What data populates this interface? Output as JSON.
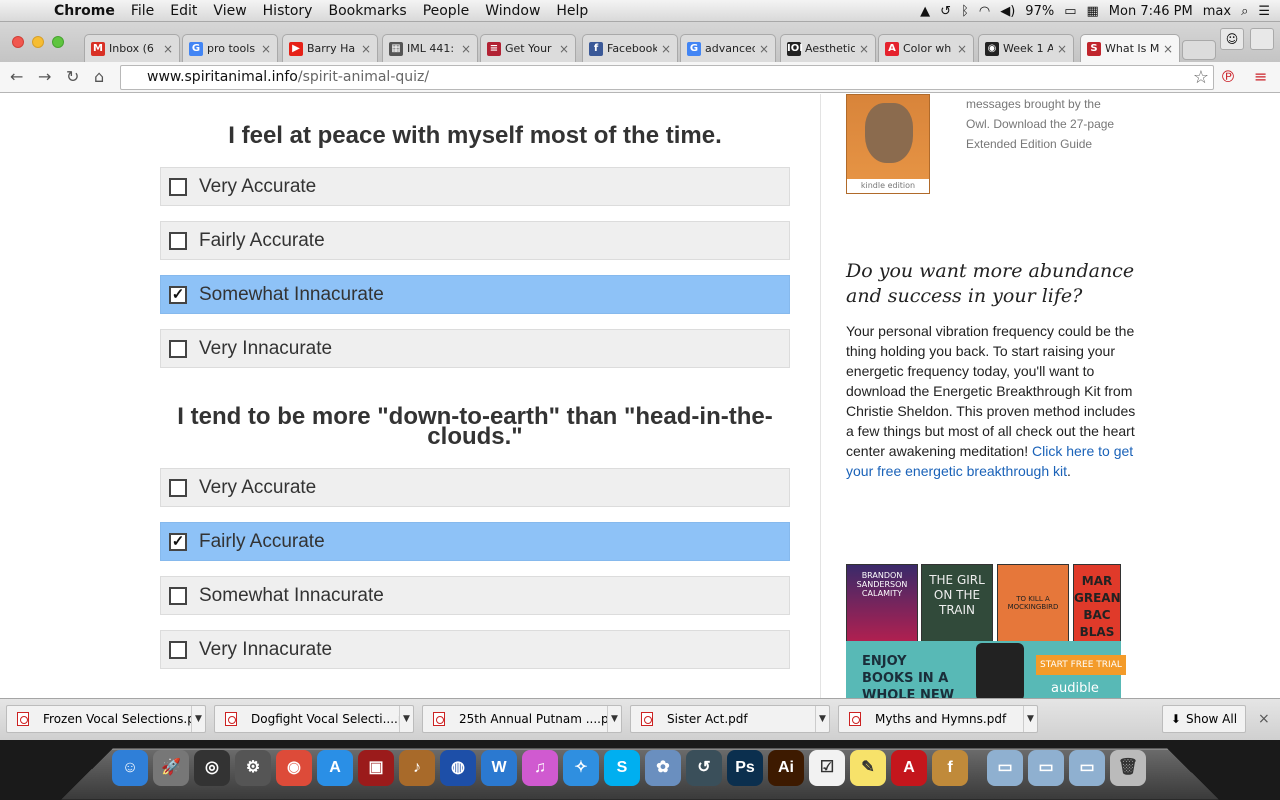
{
  "menubar": {
    "app": "Chrome",
    "items": [
      "File",
      "Edit",
      "View",
      "History",
      "Bookmarks",
      "People",
      "Window",
      "Help"
    ],
    "battery": "97%",
    "clock": "Mon 7:46 PM",
    "user": "max"
  },
  "tabs": [
    {
      "label": "Inbox (6",
      "color": "#d93025",
      "glyph": "M"
    },
    {
      "label": "pro tools",
      "color": "#4285f4",
      "glyph": "G"
    },
    {
      "label": "Barry Ha",
      "color": "#e62117",
      "glyph": "▶"
    },
    {
      "label": "IML 441:",
      "color": "#555555",
      "glyph": "▦"
    },
    {
      "label": "Get Your",
      "color": "#b22234",
      "glyph": "≡"
    },
    {
      "label": "Facebook",
      "color": "#3b5998",
      "glyph": "f"
    },
    {
      "label": "advanced",
      "color": "#4285f4",
      "glyph": "G"
    },
    {
      "label": "Aesthetic",
      "color": "#222222",
      "glyph": "IOI"
    },
    {
      "label": "Color wh",
      "color": "#e5222d",
      "glyph": "A"
    },
    {
      "label": "Week 1 A",
      "color": "#222222",
      "glyph": "◉"
    },
    {
      "label": "What Is M",
      "color": "#c0262d",
      "glyph": "S"
    }
  ],
  "url": {
    "host": "www.spiritanimal.info",
    "path": "/spirit-animal-quiz/"
  },
  "quiz": [
    {
      "question": "I feel at peace with myself most of the time.",
      "options": [
        {
          "label": "Very Accurate",
          "checked": false
        },
        {
          "label": "Fairly Accurate",
          "checked": false
        },
        {
          "label": "Somewhat Innacurate",
          "checked": true
        },
        {
          "label": "Very Innacurate",
          "checked": false
        }
      ]
    },
    {
      "question": "I tend to be more \"down-to-earth\" than \"head-in-the-clouds.\"",
      "options": [
        {
          "label": "Very Accurate",
          "checked": false
        },
        {
          "label": "Fairly Accurate",
          "checked": true
        },
        {
          "label": "Somewhat Innacurate",
          "checked": false
        },
        {
          "label": "Very Innacurate",
          "checked": false
        }
      ]
    }
  ],
  "sidebar": {
    "book_badge": "kindle edition",
    "owl_lines": [
      "messages brought by the",
      "Owl. Download the 27-page",
      "Extended Edition Guide"
    ],
    "heading": "Do you want more abundance and success in your life?",
    "body": "Your personal vibration frequency could be the thing holding you back. To start raising your energetic frequency today, you'll want to download the Energetic Breakthrough Kit from Christie Sheldon. This proven method includes a few things but most of all check out the heart center awakening meditation!",
    "link": "Click here to get your free energetic breakthrough kit",
    "ad_books": [
      "BRANDON SANDERSON CALAMITY",
      "THE GIRL ON THE TRAIN",
      "TO KILL A MOCKINGBIRD",
      "MAR GREAN BAC BLAS"
    ],
    "ad_banner": "ENJOY BOOKS IN A WHOLE NEW WAY",
    "ad_cta": "START FREE TRIAL",
    "ad_brand": "audible"
  },
  "downloads": [
    "Frozen Vocal Selections.pdf",
    "Dogfight Vocal Selecti....pdf",
    "25th Annual Putnam ....pdf",
    "Sister Act.pdf",
    "Myths and Hymns.pdf"
  ],
  "show_all": "Show All",
  "dock": [
    {
      "name": "finder",
      "color": "#2f7fd8",
      "glyph": "☺"
    },
    {
      "name": "launchpad",
      "color": "#777777",
      "glyph": "🚀"
    },
    {
      "name": "dashboard",
      "color": "#333333",
      "glyph": "◎"
    },
    {
      "name": "system-prefs",
      "color": "#555555",
      "glyph": "⚙"
    },
    {
      "name": "chrome",
      "color": "#dd4b39",
      "glyph": "◉"
    },
    {
      "name": "app-store",
      "color": "#2a8fe6",
      "glyph": "A"
    },
    {
      "name": "photo-booth",
      "color": "#9b1b1b",
      "glyph": "▣"
    },
    {
      "name": "garageband",
      "color": "#a86a2a",
      "glyph": "♪"
    },
    {
      "name": "google-earth",
      "color": "#1d4fa8",
      "glyph": "◍"
    },
    {
      "name": "word",
      "color": "#2b79d0",
      "glyph": "W"
    },
    {
      "name": "itunes",
      "color": "#d05ad0",
      "glyph": "♫"
    },
    {
      "name": "safari",
      "color": "#2f8fe0",
      "glyph": "✧"
    },
    {
      "name": "skype",
      "color": "#00aff0",
      "glyph": "S"
    },
    {
      "name": "iphoto",
      "color": "#6a8fbf",
      "glyph": "✿"
    },
    {
      "name": "time-machine",
      "color": "#3a4f5a",
      "glyph": "↺"
    },
    {
      "name": "photoshop",
      "color": "#0b2f4e",
      "glyph": "Ps"
    },
    {
      "name": "illustrator",
      "color": "#3d1a00",
      "glyph": "Ai"
    },
    {
      "name": "reminders",
      "color": "#f2f2f2",
      "glyph": "☑"
    },
    {
      "name": "stickies",
      "color": "#f7e26a",
      "glyph": "✎"
    },
    {
      "name": "acrobat",
      "color": "#c4161c",
      "glyph": "A"
    },
    {
      "name": "font-book",
      "color": "#c08a3a",
      "glyph": "f"
    },
    {
      "name": "applications-folder",
      "color": "#8fb0d0",
      "glyph": "▭"
    },
    {
      "name": "documents-folder",
      "color": "#8fb0d0",
      "glyph": "▭"
    },
    {
      "name": "downloads-folder",
      "color": "#8fb0d0",
      "glyph": "▭"
    },
    {
      "name": "trash",
      "color": "#bbbbbb",
      "glyph": "🗑"
    }
  ]
}
